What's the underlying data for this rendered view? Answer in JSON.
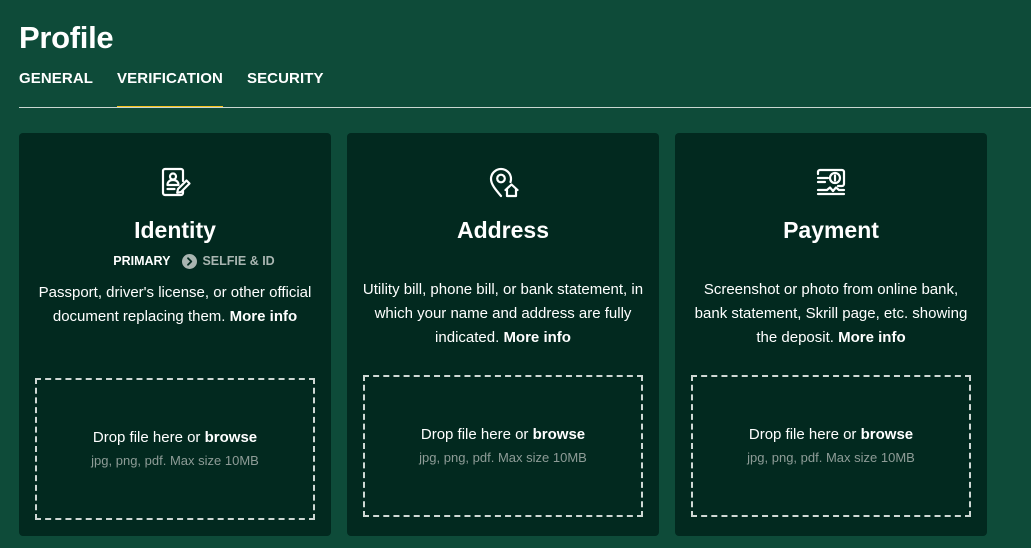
{
  "page": {
    "title": "Profile"
  },
  "tabs": [
    {
      "label": "GENERAL",
      "active": false
    },
    {
      "label": "VERIFICATION",
      "active": true
    },
    {
      "label": "SECURITY",
      "active": false
    }
  ],
  "colors": {
    "background": "#0e4b39",
    "card": "#02291f",
    "accent": "#f6c21c",
    "muted": "#a9b5b1"
  },
  "cards": [
    {
      "icon": "id-document-icon",
      "title": "Identity",
      "subtabs": {
        "primary": "PRIMARY",
        "separator_icon": "chevron-right-circle-icon",
        "secondary": "SELFIE & ID"
      },
      "description": "Passport, driver's license, or other official document replacing them.",
      "more_info": "More info",
      "dropzone": {
        "text": "Drop file here or",
        "browse": "browse",
        "hint": "jpg, png, pdf. Max size 10MB"
      }
    },
    {
      "icon": "location-home-icon",
      "title": "Address",
      "description": "Utility bill, phone bill, or bank statement, in which your name and address are fully indicated.",
      "more_info": "More info",
      "dropzone": {
        "text": "Drop file here or",
        "browse": "browse",
        "hint": "jpg, png, pdf. Max size 10MB"
      }
    },
    {
      "icon": "payment-card-icon",
      "title": "Payment",
      "description": "Screenshot or photo from online bank, bank statement, Skrill page, etc. showing the deposit.",
      "more_info": "More info",
      "dropzone": {
        "text": "Drop file here or",
        "browse": "browse",
        "hint": "jpg, png, pdf. Max size 10MB"
      }
    }
  ]
}
